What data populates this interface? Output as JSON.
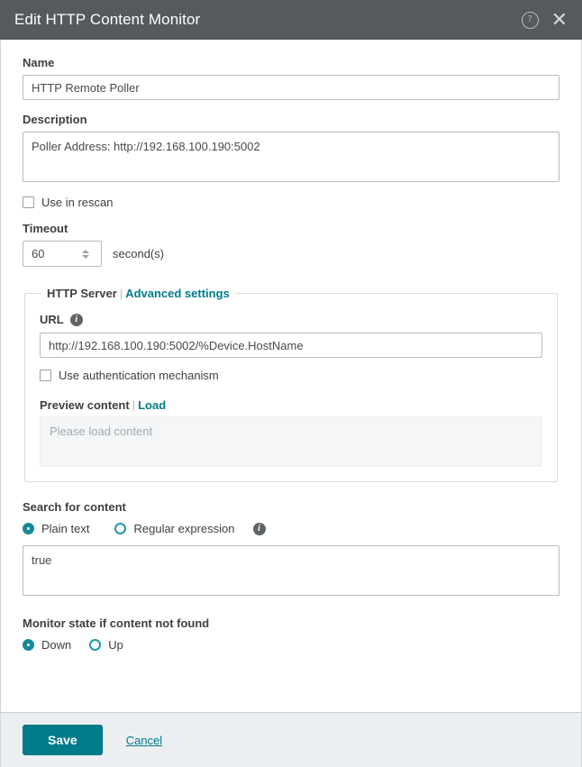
{
  "titlebar": {
    "title": "Edit HTTP Content Monitor",
    "help_icon": "help-circle-icon",
    "close_icon": "close-icon"
  },
  "form": {
    "name": {
      "label": "Name",
      "value": "HTTP Remote Poller",
      "placeholder": ""
    },
    "description": {
      "label": "Description",
      "value": "Poller Address: http://192.168.100.190:5002",
      "placeholder": ""
    },
    "use_in_rescan": {
      "label": "Use in rescan",
      "checked": false
    },
    "timeout": {
      "label": "Timeout",
      "value": "60",
      "unit": "second(s)"
    }
  },
  "http_server": {
    "legend": "HTTP Server",
    "legend_separator": "|",
    "advanced_settings_link": "Advanced settings",
    "url": {
      "label": "URL",
      "info_icon": "info-icon",
      "value": "http://192.168.100.190:5002/%Device.HostName",
      "placeholder": ""
    },
    "use_auth": {
      "label": "Use authentication mechanism",
      "checked": false
    },
    "preview": {
      "label": "Preview content",
      "separator": "|",
      "load_link": "Load",
      "placeholder_text": "Please load content"
    }
  },
  "search": {
    "label": "Search for content",
    "options": [
      {
        "label": "Plain text",
        "selected": true
      },
      {
        "label": "Regular expression",
        "selected": false
      }
    ],
    "info_icon": "info-icon",
    "value": "true",
    "placeholder": ""
  },
  "monitor_state": {
    "label": "Monitor state if content not found",
    "options": [
      {
        "label": "Down",
        "selected": true
      },
      {
        "label": "Up",
        "selected": false
      }
    ]
  },
  "footer": {
    "save_label": "Save",
    "cancel_label": "Cancel"
  },
  "colors": {
    "accent_teal": "#007b8a",
    "radio_teal": "#148a99",
    "titlebar_gray": "#555a5e",
    "footer_gray": "#eceff1"
  }
}
